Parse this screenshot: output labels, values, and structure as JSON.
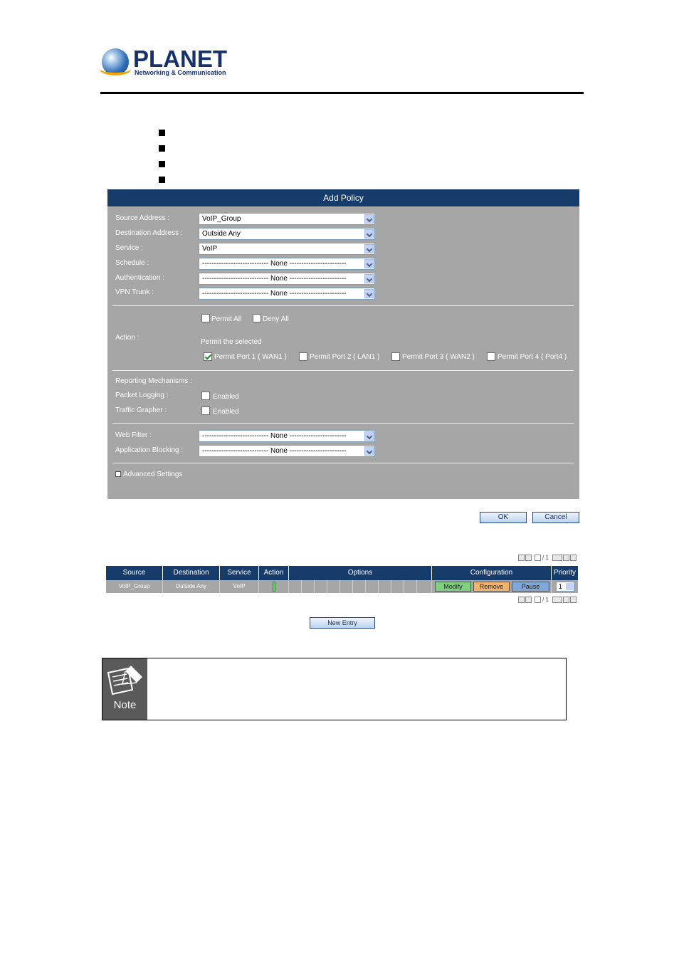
{
  "header": {
    "brand": "PLANET",
    "tagline": "Networking & Communication"
  },
  "add_policy": {
    "title": "Add Policy",
    "fields": [
      {
        "label": "Source Address :",
        "value": "VoIP_Group"
      },
      {
        "label": "Destination Address :",
        "value": "Outside Any"
      },
      {
        "label": "Service :",
        "value": "VoIP"
      },
      {
        "label": "Schedule :",
        "value": "---------------------------- None ------------------------"
      },
      {
        "label": "Authentication :",
        "value": "---------------------------- None ------------------------"
      },
      {
        "label": "VPN Trunk :",
        "value": "---------------------------- None ------------------------"
      }
    ],
    "action": {
      "label": "Action :",
      "permit_all": "Permit All",
      "deny_all": "Deny All",
      "permit_selected": "Permit the selected",
      "ports": [
        {
          "label": "Permit Port  1  ( WAN1 )",
          "checked": true
        },
        {
          "label": "Permit Port  2  ( LAN1 )",
          "checked": false
        },
        {
          "label": "Permit Port  3  ( WAN2 )",
          "checked": false
        },
        {
          "label": "Permit Port  4  ( Port4 )",
          "checked": false
        }
      ]
    },
    "reporting": {
      "label": "Reporting Mechanisms :",
      "packet_logging": "Packet Logging :",
      "traffic_grapher": "Traffic Grapher :",
      "enabled": "Enabled"
    },
    "filters": [
      {
        "label": "Web Filter :",
        "value": "---------------------------- None ------------------------"
      },
      {
        "label": "Application Blocking :",
        "value": "---------------------------- None ------------------------"
      }
    ],
    "advanced": "Advanced Settings",
    "ok": "OK",
    "cancel": "Cancel"
  },
  "policy_table": {
    "headers": [
      "Source",
      "Destination",
      "Service",
      "Action",
      "Options",
      "Configuration",
      "Priority"
    ],
    "row": {
      "source": "VoIP_Group",
      "destination": "Outside Any",
      "service": "VoIP",
      "priority": "1"
    },
    "buttons": {
      "modify": "Modify",
      "remove": "Remove",
      "pause": "Pause"
    },
    "pager_text": "/ 1",
    "new_entry": "New Entry"
  },
  "note": {
    "label": "Note"
  },
  "colors": {
    "panel": "#a6a6a6",
    "title_bar": "#163c6b",
    "modify": "#7fd07f",
    "remove": "#f2b36b",
    "pause": "#7fa7d9"
  }
}
